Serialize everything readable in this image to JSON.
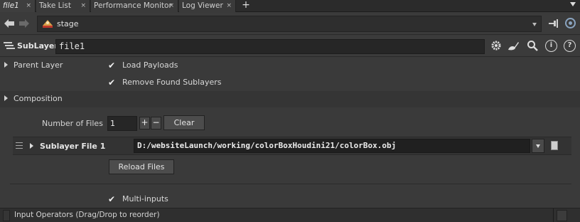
{
  "tabs": [
    {
      "label": "file1",
      "active": true
    },
    {
      "label": "Take List",
      "active": false
    },
    {
      "label": "Performance Monitor",
      "active": false
    },
    {
      "label": "Log Viewer",
      "active": false
    }
  ],
  "tab_close_glyph": "×",
  "tab_add_glyph": "+",
  "path": {
    "context": "stage"
  },
  "node": {
    "type": "SubLayer",
    "name": "file1"
  },
  "toolbar_icons": [
    "gear-icon",
    "brush-icon",
    "search-icon",
    "info-icon",
    "help-icon"
  ],
  "folders": {
    "parent_layer": "Parent Layer",
    "composition": "Composition"
  },
  "checks": {
    "load_payloads": {
      "label": "Load Payloads",
      "checked": true
    },
    "remove_found_sublayers": {
      "label": "Remove Found Sublayers",
      "checked": true
    },
    "multi_inputs": {
      "label": "Multi-inputs",
      "checked": true
    }
  },
  "num_files": {
    "label": "Number of Files",
    "value": "1",
    "plus": "+",
    "minus": "−",
    "clear_label": "Clear"
  },
  "sublayer_file": {
    "label": "Sublayer File 1",
    "value": "D:/websiteLaunch/working/colorBoxHoudini21/colorBox.obj"
  },
  "reload_label": "Reload Files",
  "input_operators": "Input Operators (Drag/Drop to reorder)",
  "check_glyph": "✔",
  "colors": {
    "background": "#3a3a3a",
    "field": "#262626",
    "text": "#d4d4d4"
  }
}
